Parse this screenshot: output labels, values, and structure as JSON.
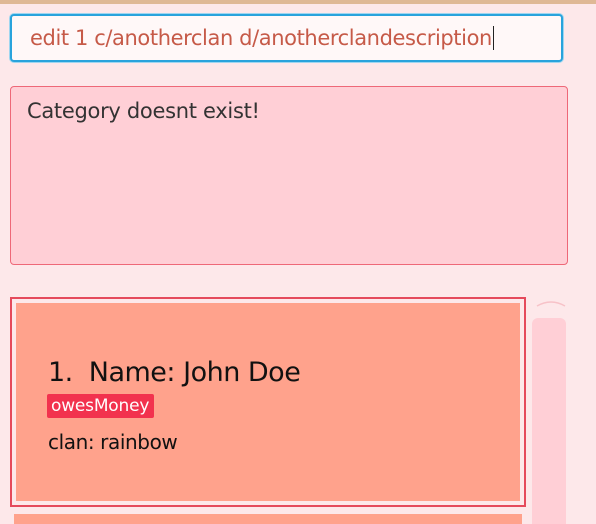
{
  "command_box": {
    "value": "edit 1 c/anotherclan d/anotherclandescription"
  },
  "result_display": {
    "message": "Category doesnt exist!"
  },
  "person_list": {
    "cards": [
      {
        "index": "1.",
        "name": "Name: John Doe",
        "tags": [
          "owesMoney"
        ],
        "clan": "clan: rainbow"
      }
    ]
  },
  "colors": {
    "accent_blue": "#29a3dc",
    "error_border": "#ee6878",
    "card_background": "#ffa28c",
    "tag_background": "#f2324e",
    "command_text": "#c65a48"
  }
}
